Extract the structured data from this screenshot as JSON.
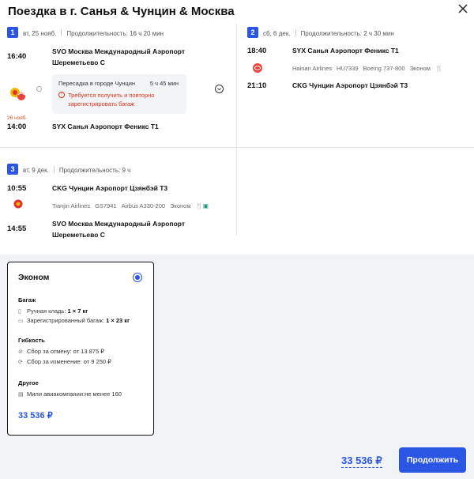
{
  "title": "Поездка в г. Санья & Чунцин & Москва",
  "segments": [
    {
      "num": "1",
      "date": "вт, 25 нояб.",
      "duration": "Продолжительность: 16 ч 20 мин",
      "dep_time": "16:40",
      "dep_airport": "SVO Москва Международный Аэропорт Шереметьево С",
      "transfer_city": "Пересадка в городе Чунцин",
      "transfer_duration": "5 ч 45 мин",
      "transfer_warning": "Требуется получить и повторно зарегистрировать багаж",
      "arr_date_note": "26 нояб.",
      "arr_time": "14:00",
      "arr_airport": "SYX Санья Аэропорт Феникс T1"
    },
    {
      "num": "2",
      "date": "сб, 6 дек.",
      "duration": "Продолжительность: 2 ч 30 мин",
      "dep_time": "18:40",
      "dep_airport": "SYX Санья Аэропорт Феникс T1",
      "airline": "Hainan Airlines",
      "flight": "HU7339",
      "aircraft": "Boeing 737-800",
      "cabin": "Эконом",
      "arr_time": "21:10",
      "arr_airport": "CKG Чунцин Аэропорт Цзянбэй T3"
    },
    {
      "num": "3",
      "date": "вт, 9 дек.",
      "duration": "Продолжительность: 9 ч",
      "dep_time": "10:55",
      "dep_airport": "CKG Чунцин Аэропорт Цзянбэй T3",
      "airline": "Tianjin Airlines",
      "flight": "GS7941",
      "aircraft": "Airbus A330-200",
      "cabin": "Эконом",
      "arr_time": "14:55",
      "arr_airport": "SVO Москва Международный Аэропорт Шереметьево С"
    }
  ],
  "fare": {
    "name": "Эконом",
    "baggage_h": "Багаж",
    "carry_on_label": "Ручная кладь:",
    "carry_on_value": "1 × 7 кг",
    "checked_label": "Зарегистрированный багаж:",
    "checked_value": "1 × 23 кг",
    "flex_h": "Гибкость",
    "cancel_fee": "Сбор за отмену: от 13 875 ₽",
    "change_fee": "Сбор за изменение: от 9 250 ₽",
    "other_h": "Другое",
    "miles": "Мили авиакомпании:не менее 160",
    "price": "33 536 ₽"
  },
  "footer": {
    "total": "33 536 ₽",
    "continue_label": "Продолжить"
  },
  "colors": {
    "accent": "#2a55e5",
    "warning": "#d9341f"
  }
}
